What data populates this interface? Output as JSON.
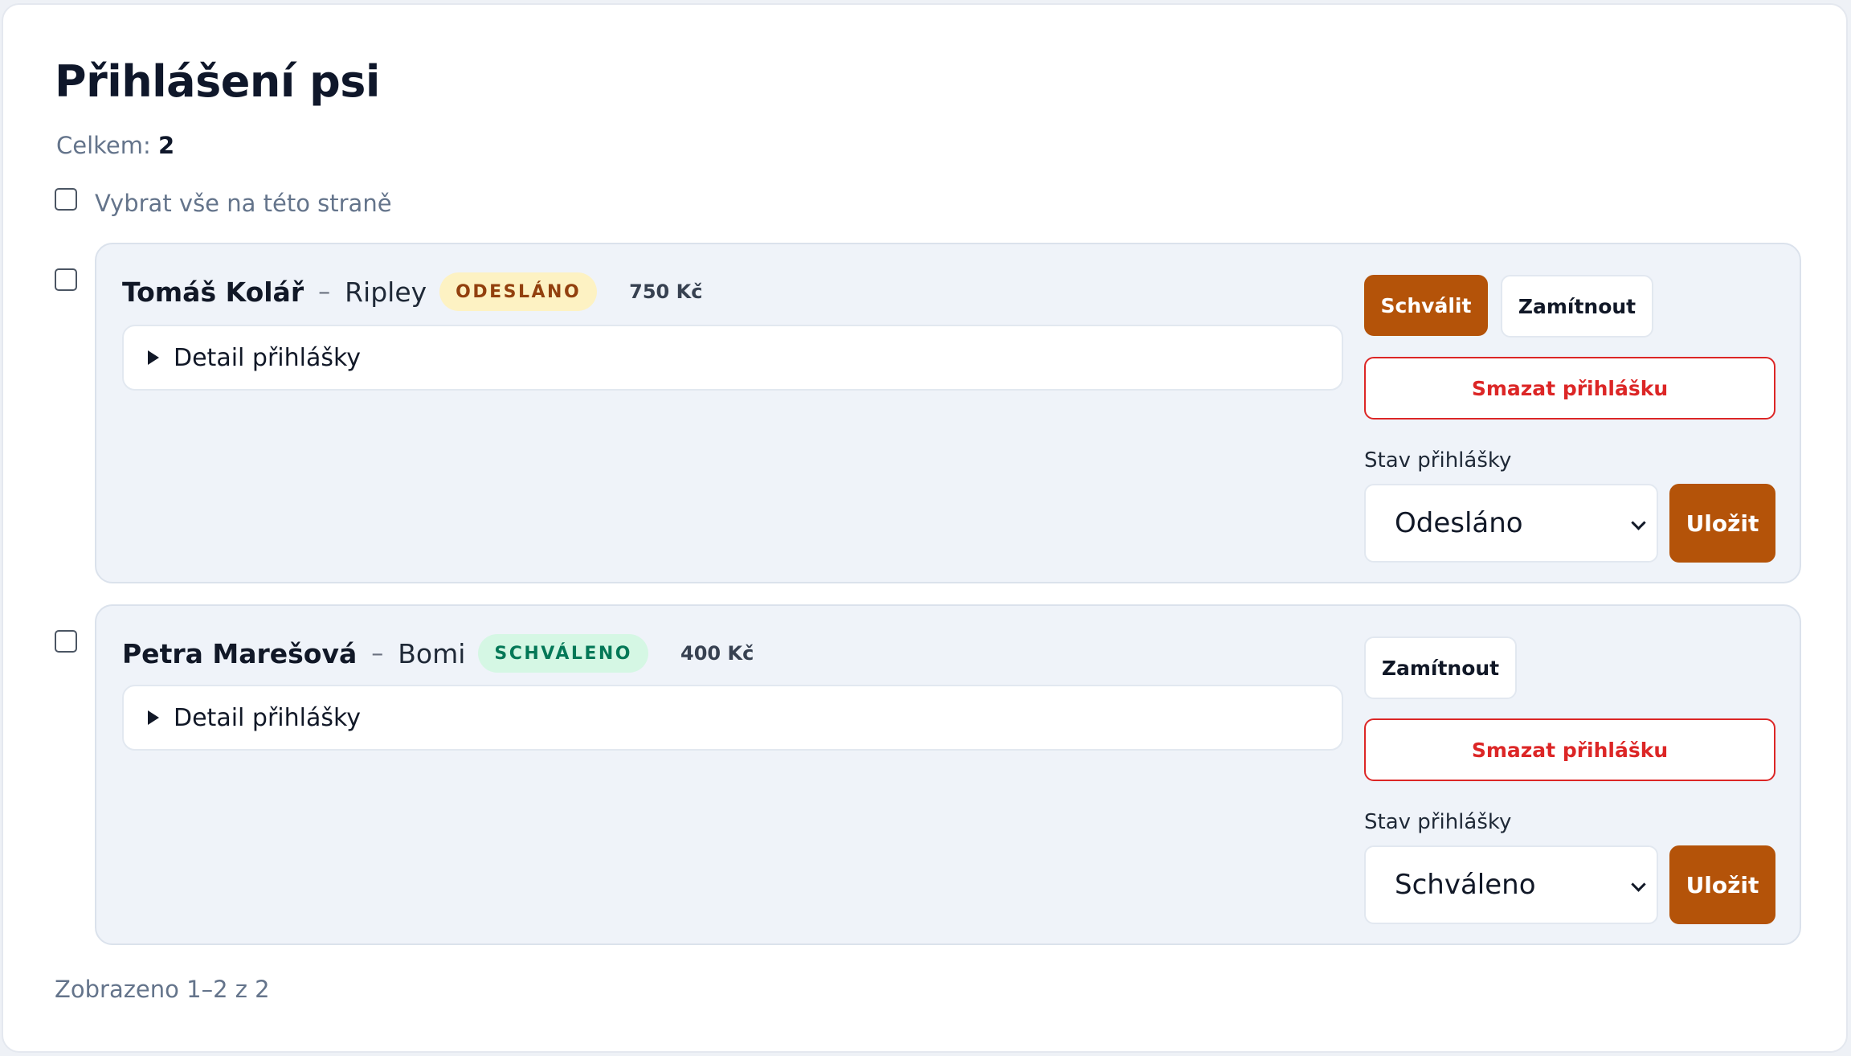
{
  "title": "Přihlášení psi",
  "total_label": "Celkem:",
  "total_count": "2",
  "select_all_label": "Vybrat vše na této straně",
  "entries": [
    {
      "owner": "Tomáš Kolář",
      "separator": "–",
      "dog": "Ripley",
      "status_badge": "ODESLÁNO",
      "price": "750 Kč",
      "detail_label": "Detail přihlášky",
      "approve_label": "Schválit",
      "reject_label": "Zamítnout",
      "delete_label": "Smazat přihlášku",
      "status_field_label": "Stav přihlášky",
      "status_value": "Odesláno",
      "save_label": "Uložit"
    },
    {
      "owner": "Petra Marešová",
      "separator": "–",
      "dog": "Bomi",
      "status_badge": "SCHVÁLENO",
      "price": "400 Kč",
      "detail_label": "Detail přihlášky",
      "reject_label": "Zamítnout",
      "delete_label": "Smazat přihlášku",
      "status_field_label": "Stav přihlášky",
      "status_value": "Schváleno",
      "save_label": "Uložit"
    }
  ],
  "footer": "Zobrazeno 1–2 z 2",
  "colors": {
    "accent": "#b45309",
    "danger": "#dc2626",
    "badge_sent_bg": "#fdf2c3",
    "badge_sent_text": "#92400e",
    "badge_ok_bg": "#d5f7e4",
    "badge_ok_text": "#047857"
  },
  "icons": {
    "disclosure": "caret-right-icon",
    "select": "chevron-down-icon"
  }
}
